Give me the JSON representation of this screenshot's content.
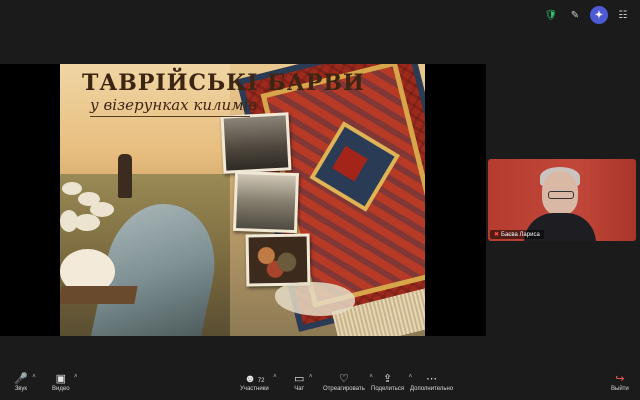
{
  "top_icons": [
    "shield-icon",
    "pen-icon",
    "sparkle-icon",
    "grid-icon"
  ],
  "slide": {
    "title_line1": "ТАВРІЙСЬКІ БАРВИ",
    "title_line2": "у візерунках килимів"
  },
  "participant": {
    "name": "Баєва Лариса"
  },
  "toolbar": {
    "audio": "Звук",
    "video": "Видео",
    "participants": "Участники",
    "participants_count": "72",
    "chat": "Чат",
    "react": "Отреагировать",
    "share": "Поделиться",
    "more": "Дополнительно",
    "leave": "Выйти"
  },
  "colors": {
    "background": "#1b1b1b",
    "accent": "#4c5bd4",
    "leave": "#ff5a5a"
  }
}
